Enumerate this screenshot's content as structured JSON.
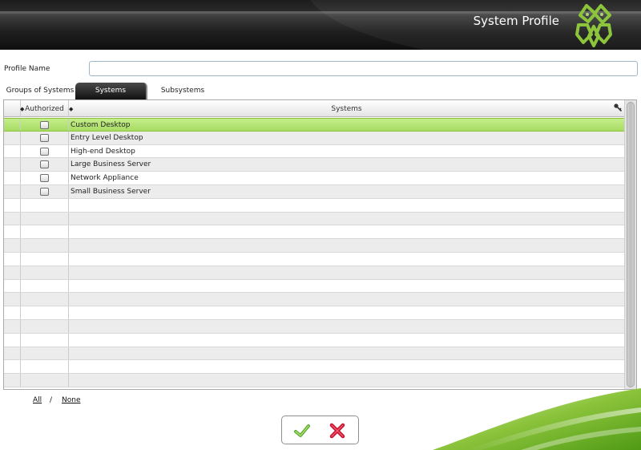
{
  "header": {
    "title": "System Profile",
    "logo_icon": "green-clover-logo"
  },
  "profile": {
    "label": "Profile Name",
    "value": ""
  },
  "tabs": [
    {
      "label": "Groups of Systems",
      "active": false
    },
    {
      "label": "Systems",
      "active": true
    },
    {
      "label": "Subsystems",
      "active": false
    }
  ],
  "grid": {
    "columns": [
      "Authorized",
      "Systems"
    ],
    "rows": [
      {
        "authorized": false,
        "system": "Custom Desktop",
        "selected": true
      },
      {
        "authorized": false,
        "system": "Entry Level Desktop",
        "selected": false
      },
      {
        "authorized": false,
        "system": "High-end Desktop",
        "selected": false
      },
      {
        "authorized": false,
        "system": "Large Business Server",
        "selected": false
      },
      {
        "authorized": false,
        "system": "Network Appliance",
        "selected": false
      },
      {
        "authorized": false,
        "system": "Small Business Server",
        "selected": false
      }
    ],
    "total_rows": 20,
    "selected_color": "#b4e474"
  },
  "selection": {
    "all_label": "All",
    "separator": "/",
    "none_label": "None"
  },
  "actions": {
    "ok_icon": "green-check-icon",
    "cancel_icon": "red-x-icon"
  },
  "colors": {
    "accent_green": "#8cc43c",
    "header_dark": "#1b1b1b"
  }
}
